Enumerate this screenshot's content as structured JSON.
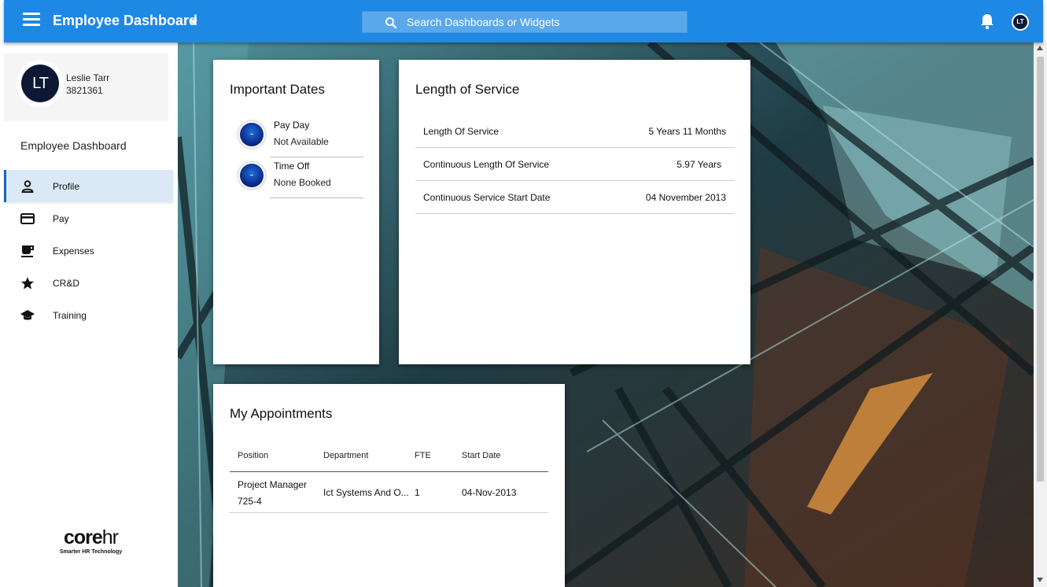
{
  "header": {
    "title": "Employee Dashboard",
    "search_placeholder": "Search Dashboards or Widgets",
    "user_initials": "LT"
  },
  "sidebar": {
    "user": {
      "initials": "LT",
      "name": "Leslie Tarr",
      "id": "3821361"
    },
    "heading": "Employee Dashboard",
    "items": [
      {
        "label": "Profile",
        "icon": "person-icon",
        "active": true
      },
      {
        "label": "Pay",
        "icon": "credit-card-icon"
      },
      {
        "label": "Expenses",
        "icon": "coffee-cup-icon"
      },
      {
        "label": "CR&D",
        "icon": "star-icon"
      },
      {
        "label": "Training",
        "icon": "graduation-cap-icon"
      }
    ],
    "brand": {
      "logo_core": "core",
      "logo_hr": "hr",
      "tagline": "Smarter HR Technology"
    }
  },
  "important_dates": {
    "title": "Important Dates",
    "items": [
      {
        "label": "Pay Day",
        "value": "Not Available"
      },
      {
        "label": "Time Off",
        "value": "None Booked"
      }
    ]
  },
  "length_of_service": {
    "title": "Length of Service",
    "rows": [
      {
        "label": "Length Of Service",
        "value": "5 Years 11 Months"
      },
      {
        "label": "Continuous Length Of Service",
        "value": "5.97 Years"
      },
      {
        "label": "Continuous Service Start Date",
        "value": "04 November  2013"
      }
    ]
  },
  "appointments": {
    "title": "My Appointments",
    "columns": [
      "Position",
      "Department",
      "FTE",
      "Start Date"
    ],
    "rows": [
      {
        "position_line1": "Project Manager",
        "position_line2": "725-4",
        "department": "Ict Systems And O...",
        "fte": "1",
        "start_date": "04-Nov-2013"
      }
    ]
  },
  "colors": {
    "header_blue": "#1e88e5",
    "active_nav": "#dbe9f6",
    "avatar_navy": "#0c1834"
  }
}
